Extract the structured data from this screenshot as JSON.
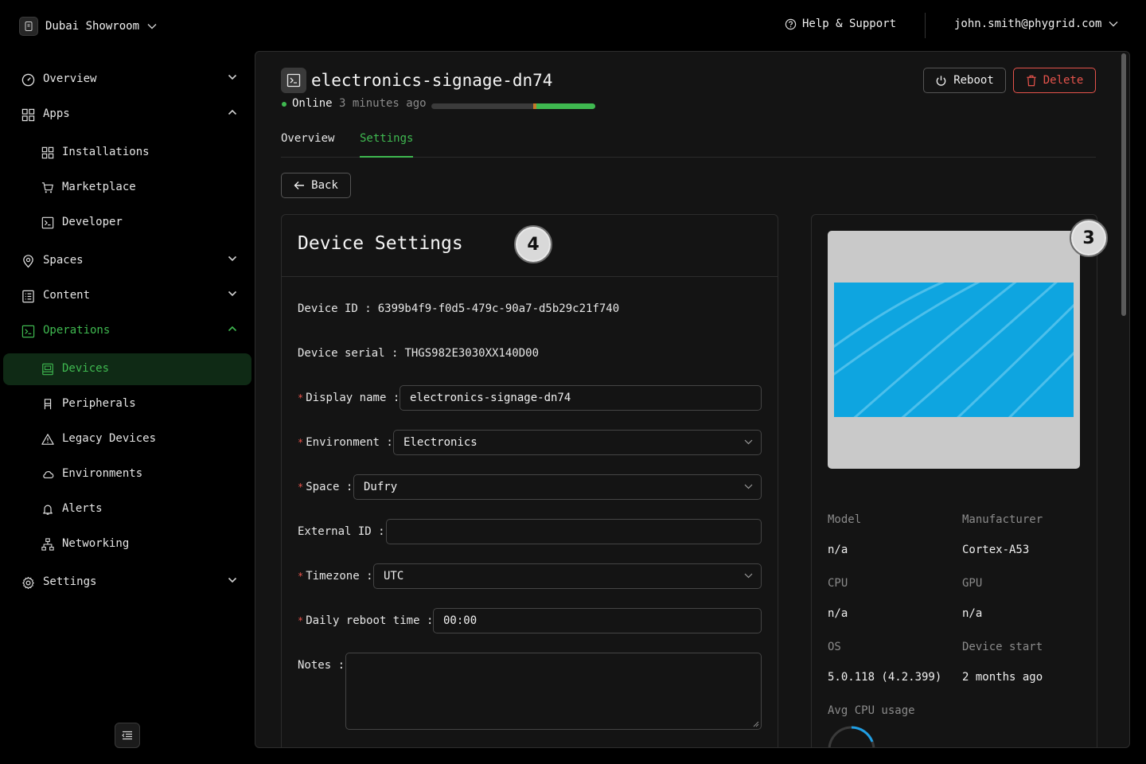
{
  "topbar": {
    "org_name": "Dubai Showroom",
    "help_label": "Help & Support",
    "user_email": "john.smith@phygrid.com"
  },
  "sidebar": {
    "items": [
      {
        "label": "Overview"
      },
      {
        "label": "Apps"
      },
      {
        "label": "Installations"
      },
      {
        "label": "Marketplace"
      },
      {
        "label": "Developer"
      },
      {
        "label": "Spaces"
      },
      {
        "label": "Content"
      },
      {
        "label": "Operations"
      },
      {
        "label": "Devices"
      },
      {
        "label": "Peripherals"
      },
      {
        "label": "Legacy Devices"
      },
      {
        "label": "Environments"
      },
      {
        "label": "Alerts"
      },
      {
        "label": "Networking"
      },
      {
        "label": "Settings"
      }
    ],
    "active_item": "Devices"
  },
  "device": {
    "name": "electronics-signage-dn74",
    "status": "Online",
    "last_seen": "3 minutes ago",
    "uptime_fraction": 0.38
  },
  "actions": {
    "reboot_label": "Reboot",
    "delete_label": "Delete"
  },
  "tabs": [
    {
      "label": "Overview",
      "active": false
    },
    {
      "label": "Settings",
      "active": true
    }
  ],
  "back_label": "Back",
  "settings_card": {
    "title": "Device Settings",
    "badge": "4",
    "fields": {
      "device_id": {
        "label": "Device ID",
        "value": "6399b4f9-f0d5-479c-90a7-d5b29c21f740"
      },
      "device_serial": {
        "label": "Device serial",
        "value": "THGS982E3030XX140D00"
      },
      "display_name": {
        "label": "Display name",
        "value": "electronics-signage-dn74",
        "required": true
      },
      "environment": {
        "label": "Environment",
        "value": "Electronics",
        "required": true
      },
      "space": {
        "label": "Space",
        "value": "Dufry",
        "required": true
      },
      "external_id": {
        "label": "External ID",
        "value": ""
      },
      "timezone": {
        "label": "Timezone",
        "value": "UTC",
        "required": true
      },
      "daily_reboot_time": {
        "label": "Daily reboot time",
        "value": "00:00",
        "required": true
      },
      "notes": {
        "label": "Notes",
        "value": ""
      }
    }
  },
  "device_info": {
    "badge": "3",
    "model_label": "Model",
    "model_value": "n/a",
    "manufacturer_label": "Manufacturer",
    "manufacturer_value": "Cortex-A53",
    "cpu_label": "CPU",
    "cpu_value": "n/a",
    "gpu_label": "GPU",
    "gpu_value": "n/a",
    "os_label": "OS",
    "os_value": "5.0.118 (4.2.399)",
    "device_start_label": "Device start",
    "device_start_value": "2 months ago",
    "avg_cpu_label": "Avg CPU usage"
  },
  "colors": {
    "accent": "#3fb950",
    "danger": "#e5534b",
    "screen_blue": "#0ea5e0"
  }
}
